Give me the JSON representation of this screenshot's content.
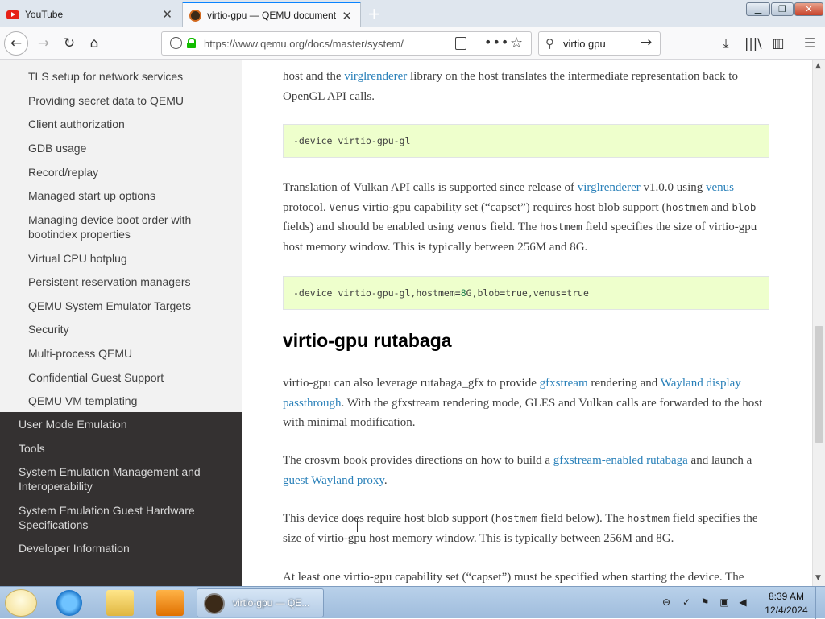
{
  "browser": {
    "tabs": [
      {
        "label": "YouTube",
        "active": false
      },
      {
        "label": "virtio-gpu — QEMU document",
        "active": true
      }
    ],
    "url": "https://www.qemu.org/docs/master/system/",
    "search_query": "virtio gpu",
    "accent_color": "#0a84ff"
  },
  "sidebar": {
    "items": [
      "TLS setup for network services",
      "Providing secret data to QEMU",
      "Client authorization",
      "GDB usage",
      "Record/replay",
      "Managed start up options",
      "Managing device boot order with bootindex properties",
      "Virtual CPU hotplug",
      "Persistent reservation managers",
      "QEMU System Emulator Targets",
      "Security",
      "Multi-process QEMU",
      "Confidential Guest Support",
      "QEMU VM templating"
    ],
    "sections": [
      "User Mode Emulation",
      "Tools",
      "System Emulation Management and Interoperability",
      "System Emulation Guest Hardware Specifications",
      "Developer Information"
    ]
  },
  "content": {
    "p1": {
      "t1": "host and the ",
      "link": "virglrenderer",
      "t2": " library on the host translates the intermediate representation back to OpenGL API calls."
    },
    "code1": "-device virtio-gpu-gl",
    "p2": {
      "t1": "Translation of Vulkan API calls is supported since release of ",
      "link1": "virglrenderer",
      "t2": " v1.0.0 using ",
      "link2": "venus",
      "t3": " protocol. ",
      "c1": "Venus",
      "t4": " virtio-gpu capability set (“capset”) requires host blob support (",
      "c2": "hostmem",
      "t5": " and ",
      "c3": "blob",
      "t6": " fields) and should be enabled using ",
      "c4": "venus",
      "t7": " field. The ",
      "c5": "hostmem",
      "t8": " field specifies the size of virtio-gpu host memory window. This is typically between 256M and 8G."
    },
    "code2": {
      "prefix": "-device virtio-gpu-gl,hostmem=",
      "num": "8",
      "suffix": "G,blob=true,venus=true"
    },
    "heading": "virtio-gpu rutabaga",
    "p3": {
      "t1": "virtio-gpu can also leverage rutabaga_gfx to provide ",
      "link1": "gfxstream",
      "t2": " rendering and ",
      "link2": "Wayland display passthrough",
      "t3": ". With the gfxstream rendering mode, GLES and Vulkan calls are forwarded to the host with minimal modification."
    },
    "p4": {
      "t1": "The crosvm book provides directions on how to build a ",
      "link1": "gfxstream-enabled rutabaga",
      "t2": " and launch a ",
      "link2": "guest Wayland proxy",
      "t3": "."
    },
    "p5": {
      "t1": "This device does require host blob support (",
      "c1": "hostmem",
      "t2": " field below). The ",
      "c2": "hostmem",
      "t3": " field specifies the size of virtio-gpu host memory window. This is typically between 256M and 8G."
    },
    "p6": "At least one virtio-gpu capability set (“capset”) must be specified when starting the device. The"
  },
  "taskbar": {
    "active_window_label": "virtio-gpu — QE...",
    "time": "8:39 AM",
    "date": "12/4/2024"
  },
  "icons": [
    "youtube-icon",
    "qemu-favicon",
    "back-arrow-icon",
    "forward-arrow-icon",
    "reload-icon",
    "home-icon",
    "info-icon",
    "lock-icon",
    "reader-view-icon",
    "page-actions-icon",
    "bookmark-star-icon",
    "search-icon",
    "go-arrow-icon",
    "download-icon",
    "library-icon",
    "sidebar-icon",
    "menu-icon"
  ]
}
